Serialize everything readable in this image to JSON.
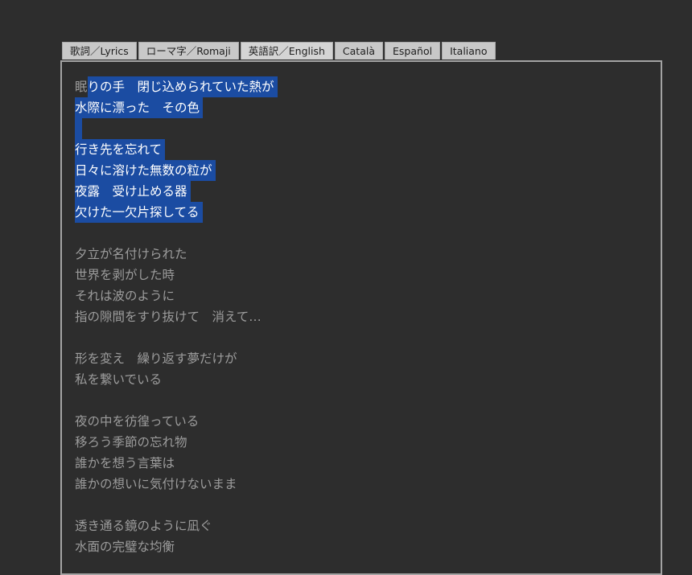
{
  "tabs": [
    {
      "label": "歌詞／Lyrics",
      "active": false
    },
    {
      "label": "ローマ字／Romaji",
      "active": false
    },
    {
      "label": "英語訳／English",
      "active": true
    },
    {
      "label": "Català",
      "active": false
    },
    {
      "label": "Español",
      "active": false
    },
    {
      "label": "Italiano",
      "active": false
    }
  ],
  "lyrics": {
    "selected_first_prefix": "眠",
    "selected_first_rest": "りの手　閉じ込められていた熱が",
    "selected": [
      "水際に漂った　その色",
      "",
      "行き先を忘れて",
      "日々に溶けた無数の粒が",
      "夜露　受け止める器",
      "欠けた一欠片探してる"
    ],
    "lines": [
      "",
      "夕立が名付けられた",
      "世界を剥がした時",
      "それは波のように",
      "指の隙間をすり抜けて　消えて…",
      "",
      "形を変え　繰り返す夢だけが",
      "私を繋いでいる",
      "",
      "夜の中を彷徨っている",
      "移ろう季節の忘れ物",
      "誰かを想う言葉は",
      "誰かの想いに気付けないまま",
      "",
      "透き通る鏡のように凪ぐ",
      "水面の完璧な均衡"
    ]
  },
  "colors": {
    "background": "#2d2d2d",
    "selection": "#1b4ca2",
    "text": "#9c9c9c",
    "tab": "#c8c8c8"
  }
}
